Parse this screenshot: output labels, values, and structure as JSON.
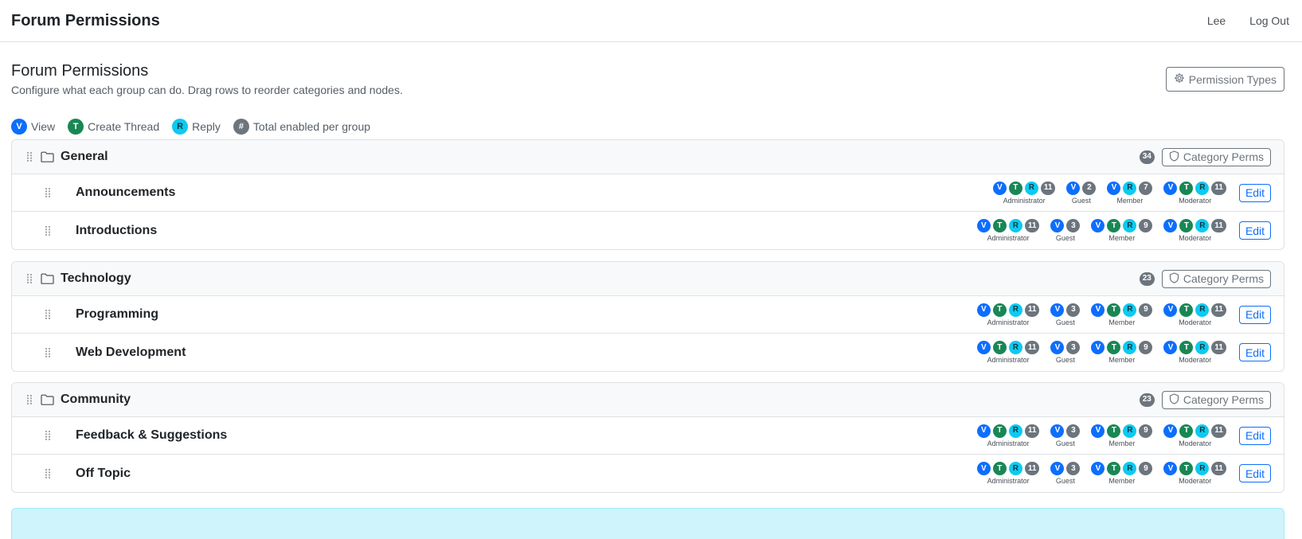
{
  "navbar": {
    "brand": "Forum Permissions",
    "user": "Lee",
    "logout": "Log Out"
  },
  "page": {
    "title": "Forum Permissions",
    "subtitle": "Configure what each group can do. Drag rows to reorder categories and nodes.",
    "perm_types_button": "Permission Types"
  },
  "legend": [
    {
      "badge": "V",
      "label": "View",
      "color": "#0d6efd"
    },
    {
      "badge": "T",
      "label": "Create Thread",
      "color": "#198754"
    },
    {
      "badge": "R",
      "label": "Reply",
      "color": "#0dcaf0"
    },
    {
      "badge": "#",
      "label": "Total enabled per group",
      "color": "#6c757d"
    }
  ],
  "category_perms_label": "Category Perms",
  "edit_label": "Edit",
  "categories": [
    {
      "name": "General",
      "total": "34",
      "nodes": [
        {
          "name": "Announcements",
          "groups": [
            {
              "label": "Administrator",
              "perms": [
                "V",
                "T",
                "R"
              ],
              "count": "11"
            },
            {
              "label": "Guest",
              "perms": [
                "V"
              ],
              "count": "2"
            },
            {
              "label": "Member",
              "perms": [
                "V",
                "R"
              ],
              "count": "7"
            },
            {
              "label": "Moderator",
              "perms": [
                "V",
                "T",
                "R"
              ],
              "count": "11"
            }
          ]
        },
        {
          "name": "Introductions",
          "groups": [
            {
              "label": "Administrator",
              "perms": [
                "V",
                "T",
                "R"
              ],
              "count": "11"
            },
            {
              "label": "Guest",
              "perms": [
                "V"
              ],
              "count": "3"
            },
            {
              "label": "Member",
              "perms": [
                "V",
                "T",
                "R"
              ],
              "count": "9"
            },
            {
              "label": "Moderator",
              "perms": [
                "V",
                "T",
                "R"
              ],
              "count": "11"
            }
          ]
        }
      ]
    },
    {
      "name": "Technology",
      "total": "23",
      "nodes": [
        {
          "name": "Programming",
          "groups": [
            {
              "label": "Administrator",
              "perms": [
                "V",
                "T",
                "R"
              ],
              "count": "11"
            },
            {
              "label": "Guest",
              "perms": [
                "V"
              ],
              "count": "3"
            },
            {
              "label": "Member",
              "perms": [
                "V",
                "T",
                "R"
              ],
              "count": "9"
            },
            {
              "label": "Moderator",
              "perms": [
                "V",
                "T",
                "R"
              ],
              "count": "11"
            }
          ]
        },
        {
          "name": "Web Development",
          "groups": [
            {
              "label": "Administrator",
              "perms": [
                "V",
                "T",
                "R"
              ],
              "count": "11"
            },
            {
              "label": "Guest",
              "perms": [
                "V"
              ],
              "count": "3"
            },
            {
              "label": "Member",
              "perms": [
                "V",
                "T",
                "R"
              ],
              "count": "9"
            },
            {
              "label": "Moderator",
              "perms": [
                "V",
                "T",
                "R"
              ],
              "count": "11"
            }
          ]
        }
      ]
    },
    {
      "name": "Community",
      "total": "23",
      "nodes": [
        {
          "name": "Feedback & Suggestions",
          "groups": [
            {
              "label": "Administrator",
              "perms": [
                "V",
                "T",
                "R"
              ],
              "count": "11"
            },
            {
              "label": "Guest",
              "perms": [
                "V"
              ],
              "count": "3"
            },
            {
              "label": "Member",
              "perms": [
                "V",
                "T",
                "R"
              ],
              "count": "9"
            },
            {
              "label": "Moderator",
              "perms": [
                "V",
                "T",
                "R"
              ],
              "count": "11"
            }
          ]
        },
        {
          "name": "Off Topic",
          "groups": [
            {
              "label": "Administrator",
              "perms": [
                "V",
                "T",
                "R"
              ],
              "count": "11"
            },
            {
              "label": "Guest",
              "perms": [
                "V"
              ],
              "count": "3"
            },
            {
              "label": "Member",
              "perms": [
                "V",
                "T",
                "R"
              ],
              "count": "9"
            },
            {
              "label": "Moderator",
              "perms": [
                "V",
                "T",
                "R"
              ],
              "count": "11"
            }
          ]
        }
      ]
    }
  ]
}
